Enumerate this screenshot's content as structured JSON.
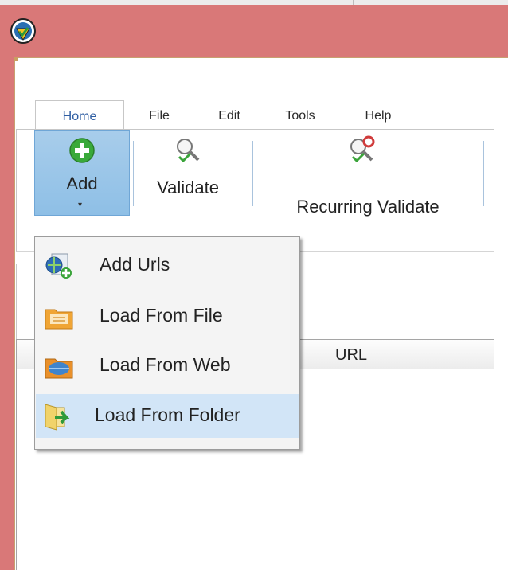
{
  "window": {
    "icon": "url-validator-app-icon"
  },
  "tabs": [
    {
      "label": "Home",
      "active": true
    },
    {
      "label": "File",
      "active": false
    },
    {
      "label": "Edit",
      "active": false
    },
    {
      "label": "Tools",
      "active": false
    },
    {
      "label": "Help",
      "active": false
    }
  ],
  "ribbon": {
    "add": {
      "label": "Add",
      "icon": "green-plus-circle-icon",
      "pressed": true
    },
    "validate": {
      "label": "Validate",
      "icon": "magnifier-check-icon"
    },
    "recurring": {
      "label": "Recurring Validate",
      "icon": "magnifier-recurring-icon"
    }
  },
  "dropdown": {
    "items": [
      {
        "label": "Add Urls",
        "icon": "globe-add-icon"
      },
      {
        "label": "Load From File",
        "icon": "file-folder-icon"
      },
      {
        "label": "Load From Web",
        "icon": "web-folder-icon"
      },
      {
        "label": "Load From Folder",
        "icon": "folder-arrow-icon",
        "hovered": true
      }
    ]
  },
  "grid": {
    "columns": [
      "URL"
    ]
  },
  "colors": {
    "titlebar": "#d97878",
    "pressed_button": "#9cc6ea",
    "menu_hover": "#d2e5f7",
    "active_tab_text": "#2f5ea3"
  }
}
